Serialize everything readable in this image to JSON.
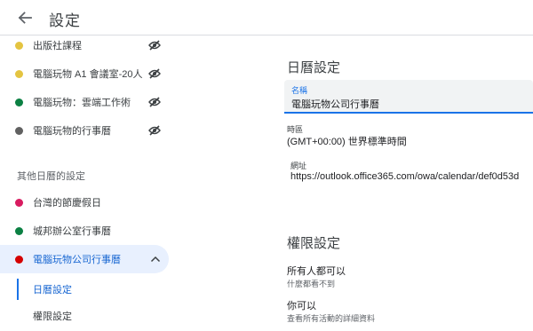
{
  "header": {
    "title": "設定",
    "back_icon": "arrow-back-icon"
  },
  "sidebar": {
    "calendars_top": [
      {
        "label": "出版社課程",
        "color": "#e4c441",
        "hidden_icon": "eye-off-icon"
      },
      {
        "label": "電腦玩物 A1 會議室-20人",
        "color": "#e4c441",
        "hidden_icon": "eye-off-icon"
      },
      {
        "label": "電腦玩物：雲端工作術",
        "color": "#0b8043",
        "hidden_icon": "eye-off-icon"
      },
      {
        "label": "電腦玩物的行事曆",
        "color": "#616161",
        "hidden_icon": "eye-off-icon"
      }
    ],
    "other_section_label": "其他日曆的設定",
    "other_calendars": [
      {
        "label": "台灣的節慶假日",
        "color": "#d81b60"
      },
      {
        "label": "城邦辦公室行事曆",
        "color": "#0b8043"
      },
      {
        "label": "電腦玩物公司行事曆",
        "color": "#d50000"
      }
    ],
    "sub_items": [
      {
        "label": "日曆設定",
        "active": true
      },
      {
        "label": "權限設定",
        "active": false
      }
    ]
  },
  "main": {
    "calendar_settings_title": "日曆設定",
    "name_field": {
      "label": "名稱",
      "value": "電腦玩物公司行事曆"
    },
    "timezone": {
      "label": "時區",
      "value": "(GMT+00:00) 世界標準時間"
    },
    "url": {
      "label": "網址",
      "value": "https://outlook.office365.com/owa/calendar/def0d53d"
    },
    "permission_title": "權限設定",
    "permissions": [
      {
        "title": "所有人都可以",
        "desc": "什麼都看不到"
      },
      {
        "title": "你可以",
        "desc": "查看所有活動的詳細資料"
      }
    ]
  },
  "colors": {
    "accent": "#1a73e8",
    "selected_bg": "#e8f0fe",
    "divider": "#dadce0"
  }
}
